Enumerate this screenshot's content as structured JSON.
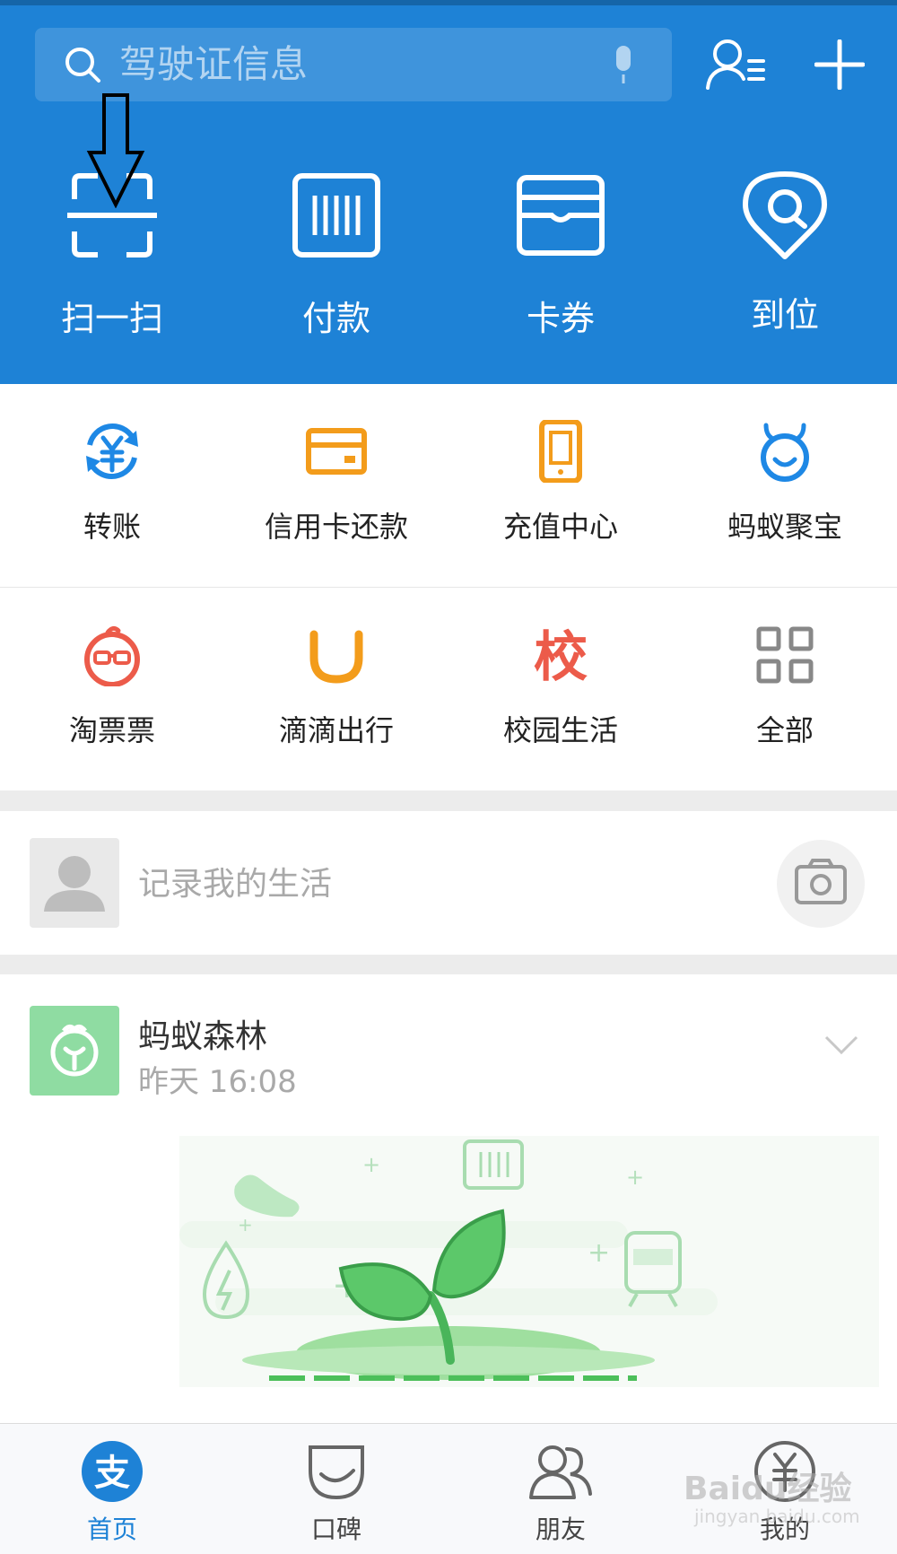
{
  "search": {
    "placeholder": "驾驶证信息"
  },
  "top_actions": [
    {
      "label": "扫一扫",
      "icon": "scan-icon"
    },
    {
      "label": "付款",
      "icon": "barcode-icon"
    },
    {
      "label": "卡券",
      "icon": "card-wallet-icon"
    },
    {
      "label": "到位",
      "icon": "location-pin-icon"
    }
  ],
  "grid_row1": [
    {
      "label": "转账",
      "icon": "transfer-yuan-icon",
      "color": "#1e88e5"
    },
    {
      "label": "信用卡还款",
      "icon": "credit-card-icon",
      "color": "#f39c1b"
    },
    {
      "label": "充值中心",
      "icon": "phone-recharge-icon",
      "color": "#f39c1b"
    },
    {
      "label": "蚂蚁聚宝",
      "icon": "ant-fortune-icon",
      "color": "#1e88e5"
    }
  ],
  "grid_row2": [
    {
      "label": "淘票票",
      "icon": "taopiaopiao-icon",
      "color": "#ec5b4a"
    },
    {
      "label": "滴滴出行",
      "icon": "didi-icon",
      "color": "#f39c1b"
    },
    {
      "label": "校园生活",
      "icon": "campus-icon",
      "glyph": "校",
      "color": "#ec5b4a"
    },
    {
      "label": "全部",
      "icon": "all-apps-grid-icon",
      "color": "#888888"
    }
  ],
  "post": {
    "placeholder": "记录我的生活"
  },
  "feed_card": {
    "title": "蚂蚁森林",
    "time": "昨天 16:08"
  },
  "tabs": [
    {
      "label": "首页",
      "icon": "alipay-home-icon",
      "active": true
    },
    {
      "label": "口碑",
      "icon": "koubei-icon",
      "active": false
    },
    {
      "label": "朋友",
      "icon": "friends-icon",
      "active": false
    },
    {
      "label": "我的",
      "icon": "my-account-icon",
      "active": false
    }
  ],
  "watermark": {
    "brand": "Baidu经验",
    "url": "jingyan.baidu.com"
  },
  "colors": {
    "primary": "#1e82d6",
    "orange": "#f39c1b",
    "red": "#ec5b4a",
    "green": "#6cc96f"
  }
}
